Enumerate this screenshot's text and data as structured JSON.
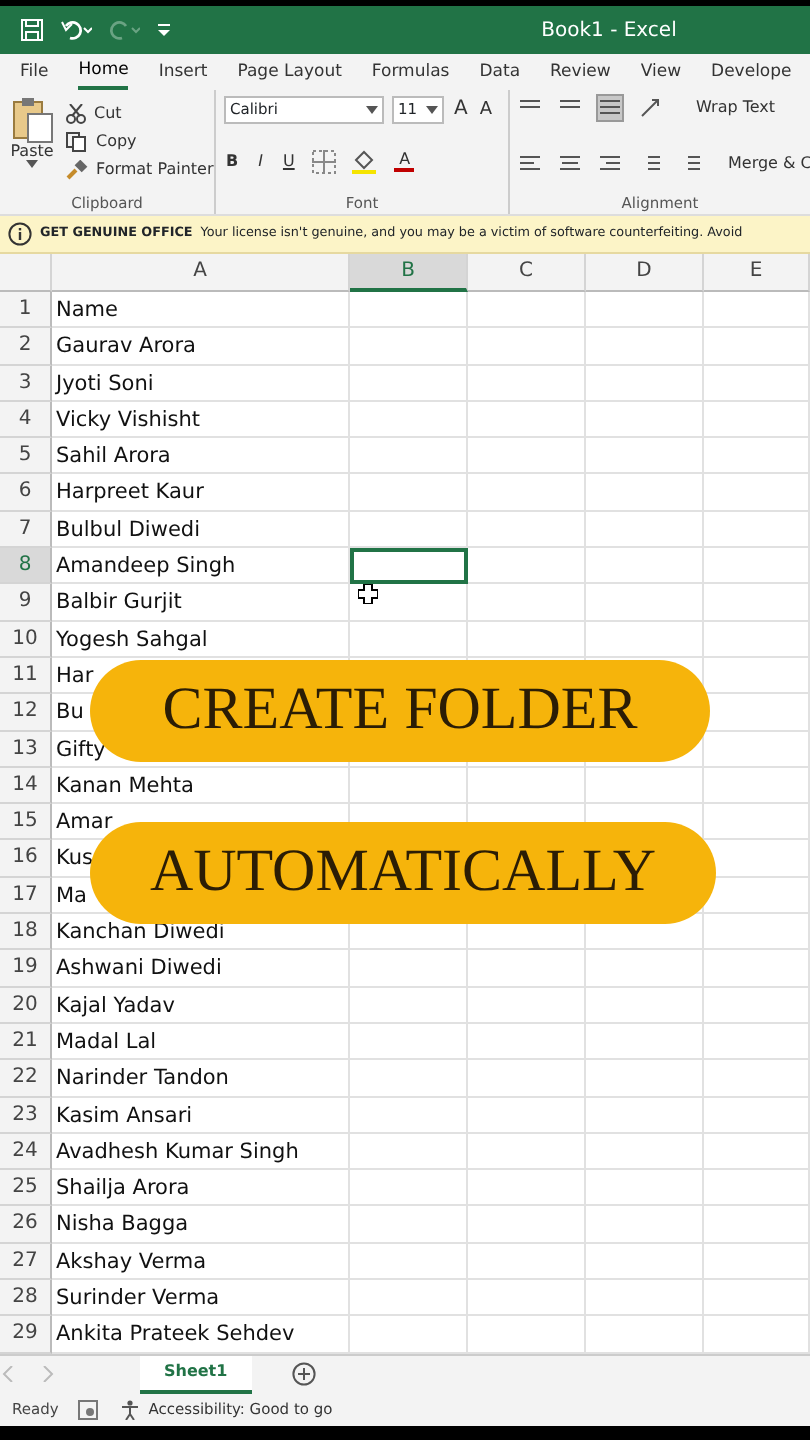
{
  "title_bar": {
    "title": "Book1  -  Excel"
  },
  "ribbon_tabs": [
    {
      "label": "File",
      "selected": false
    },
    {
      "label": "Home",
      "selected": true
    },
    {
      "label": "Insert",
      "selected": false
    },
    {
      "label": "Page Layout",
      "selected": false
    },
    {
      "label": "Formulas",
      "selected": false
    },
    {
      "label": "Data",
      "selected": false
    },
    {
      "label": "Review",
      "selected": false
    },
    {
      "label": "View",
      "selected": false
    },
    {
      "label": "Develope",
      "selected": false
    }
  ],
  "clipboard": {
    "paste": "Paste",
    "cut": "Cut",
    "copy": "Copy",
    "format_painter": "Format Painter",
    "group": "Clipboard"
  },
  "font": {
    "name": "Calibri",
    "size": "11",
    "grow": "A",
    "shrink": "A",
    "bold": "B",
    "italic": "I",
    "underline": "U",
    "font_color_label": "A",
    "group": "Font"
  },
  "alignment": {
    "wrap_text": "Wrap Text",
    "merge": "Merge & C",
    "group": "Alignment"
  },
  "notice": {
    "title": "GET GENUINE OFFICE",
    "message": "Your license isn't genuine, and you may be a victim of software counterfeiting. Avoid"
  },
  "columns": [
    {
      "label": "A",
      "selected": false
    },
    {
      "label": "B",
      "selected": true
    },
    {
      "label": "C",
      "selected": false
    },
    {
      "label": "D",
      "selected": false
    },
    {
      "label": "E",
      "selected": false
    }
  ],
  "rows": [
    {
      "number": "1",
      "name": "Name",
      "selected": false
    },
    {
      "number": "2",
      "name": "Gaurav Arora",
      "selected": false
    },
    {
      "number": "3",
      "name": "Jyoti Soni",
      "selected": false
    },
    {
      "number": "4",
      "name": "Vicky Vishisht",
      "selected": false
    },
    {
      "number": "5",
      "name": "Sahil Arora",
      "selected": false
    },
    {
      "number": "6",
      "name": "Harpreet Kaur",
      "selected": false
    },
    {
      "number": "7",
      "name": "Bulbul Diwedi",
      "selected": false
    },
    {
      "number": "8",
      "name": "Amandeep Singh",
      "selected": true
    },
    {
      "number": "9",
      "name": "Balbir Gurjit",
      "selected": false
    },
    {
      "number": "10",
      "name": "Yogesh Sahgal",
      "selected": false
    },
    {
      "number": "11",
      "name": "Har",
      "selected": false
    },
    {
      "number": "12",
      "name": "Bu",
      "selected": false
    },
    {
      "number": "13",
      "name": "Gifty",
      "selected": false
    },
    {
      "number": "14",
      "name": "Kanan Mehta",
      "selected": false
    },
    {
      "number": "15",
      "name": "Amar",
      "selected": false
    },
    {
      "number": "16",
      "name": "Kus",
      "selected": false
    },
    {
      "number": "17",
      "name": "Ma",
      "selected": false
    },
    {
      "number": "18",
      "name": "Kanchan Diwedi",
      "selected": false
    },
    {
      "number": "19",
      "name": "Ashwani Diwedi",
      "selected": false
    },
    {
      "number": "20",
      "name": "Kajal Yadav",
      "selected": false
    },
    {
      "number": "21",
      "name": "Madal Lal",
      "selected": false
    },
    {
      "number": "22",
      "name": "Narinder Tandon",
      "selected": false
    },
    {
      "number": "23",
      "name": "Kasim Ansari",
      "selected": false
    },
    {
      "number": "24",
      "name": "Avadhesh Kumar Singh",
      "selected": false
    },
    {
      "number": "25",
      "name": "Shailja Arora",
      "selected": false
    },
    {
      "number": "26",
      "name": "Nisha Bagga",
      "selected": false
    },
    {
      "number": "27",
      "name": "Akshay Verma",
      "selected": false
    },
    {
      "number": "28",
      "name": "Surinder Verma",
      "selected": false
    },
    {
      "number": "29",
      "name": "Ankita Prateek Sehdev",
      "selected": false
    }
  ],
  "overlay": [
    "CREATE FOLDER",
    "AUTOMATICALLY"
  ],
  "sheet_tabs": [
    {
      "label": "Sheet1",
      "selected": true
    }
  ],
  "status_bar": {
    "ready": "Ready",
    "accessibility": "Accessibility: Good to go"
  }
}
